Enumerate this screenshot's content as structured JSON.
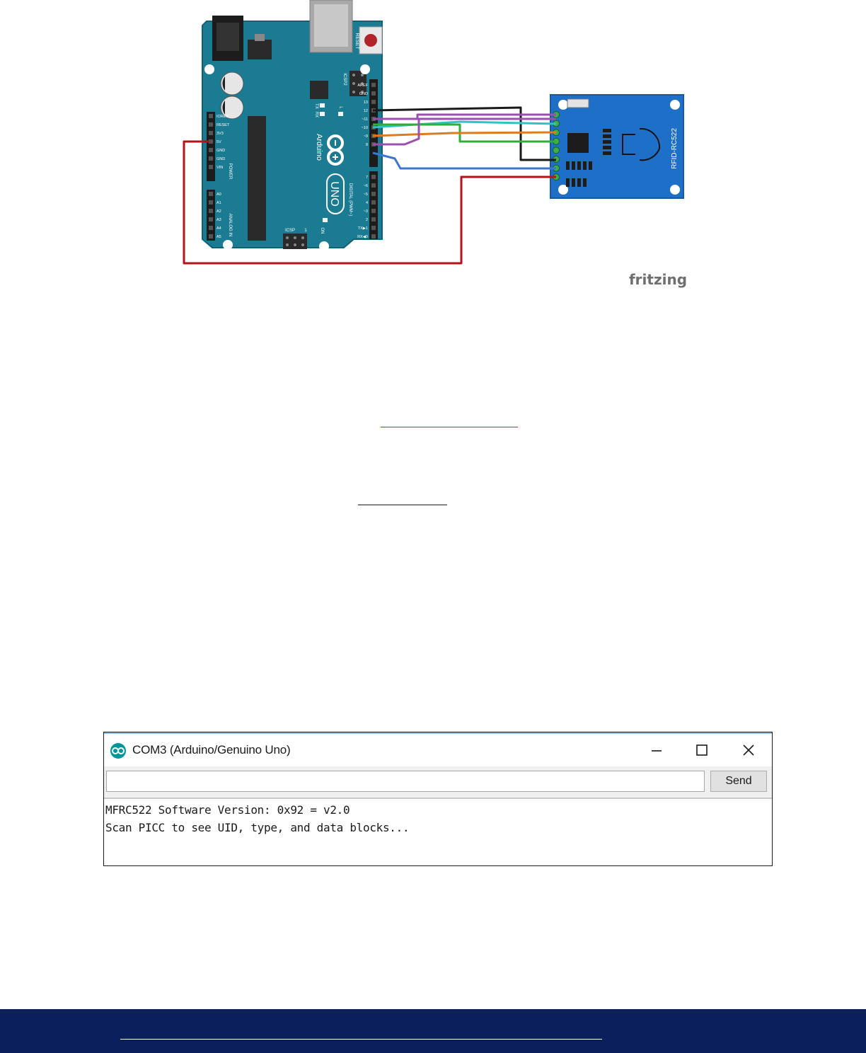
{
  "diagram": {
    "board_name": "UNO",
    "board_brand": "Arduino",
    "board_labels": {
      "reset": "RESET",
      "icsp2": "ICSP2",
      "icsp": "ICSP",
      "tx": "TX",
      "rx": "RX",
      "l": "L",
      "on": "ON",
      "digital": "DIGITAL (PWM~)",
      "power": "POWER",
      "analog": "ANALOG IN",
      "icsp_pin": "1"
    },
    "power_pins": [
      "IOREF",
      "RESET",
      "3V3",
      "5V",
      "GND",
      "GND",
      "VIN"
    ],
    "analog_pins": [
      "A0",
      "A1",
      "A2",
      "A3",
      "A4",
      "A5"
    ],
    "digital_pins_top": [
      "AREF",
      "GND",
      "13",
      "12",
      "~11",
      "~10",
      "~9",
      "8"
    ],
    "digital_pins_bottom": [
      "7",
      "~6",
      "~5",
      "4",
      "~3",
      "2",
      "TX▶1",
      "RX◀0"
    ],
    "module_label": "RFID-RC522",
    "watermark": "fritzing",
    "wire_colors": {
      "gnd": "#1a1a1a",
      "d13": "#9b4fb0",
      "d12": "#2ec4c4",
      "d11": "#e07a1f",
      "d10": "#9b4fb0",
      "d9": "#3a77d0",
      "v33": "#b3131a",
      "green": "#2fae3a"
    }
  },
  "serial_monitor": {
    "title": "COM3 (Arduino/Genuino Uno)",
    "input_value": "",
    "send_label": "Send",
    "output_lines": [
      "MFRC522 Software Version: 0x92 = v2.0",
      "Scan PICC to see UID, type, and data blocks..."
    ]
  },
  "colors": {
    "board": "#1b7b93",
    "module": "#1e6fc8",
    "footer": "#0a1f5c"
  }
}
